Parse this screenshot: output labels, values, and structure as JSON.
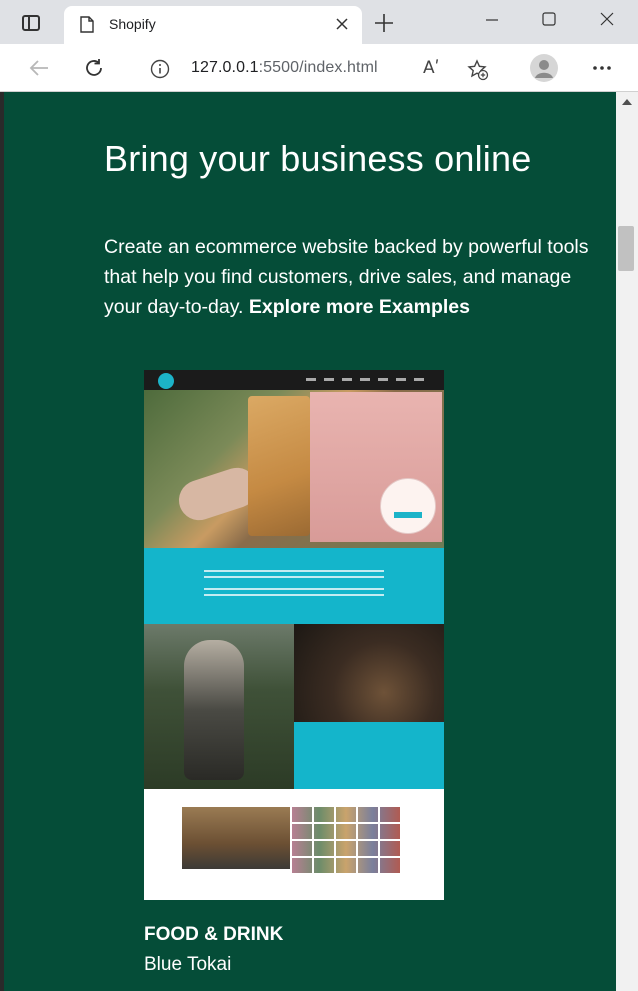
{
  "browser": {
    "tab": {
      "title": "Shopify"
    },
    "address": {
      "host": "127.0.0.1",
      "path": ":5500/index.html"
    },
    "read_aloud_glyph": "Aʹ",
    "icons": [
      "sidebar-toggle-icon",
      "page-icon",
      "close-icon",
      "plus-icon",
      "minimize-icon",
      "maximize-icon",
      "window-close-icon",
      "back-arrow-icon",
      "reload-icon",
      "info-icon",
      "read-aloud-icon",
      "favorites-add-icon",
      "profile-icon",
      "more-icon"
    ]
  },
  "page": {
    "hero": {
      "title": "Bring your business online",
      "description": "Create an ecommerce website backed by powerful tools that help you find customers, drive sales, and manage your day-to-day.",
      "link_label": "Explore more Examples"
    },
    "example": {
      "category": "FOOD & DRINK",
      "name": "Blue Tokai"
    },
    "colors": {
      "page_background": "#054d38",
      "text": "#ffffff",
      "example_accent": "#14b5cb"
    }
  }
}
